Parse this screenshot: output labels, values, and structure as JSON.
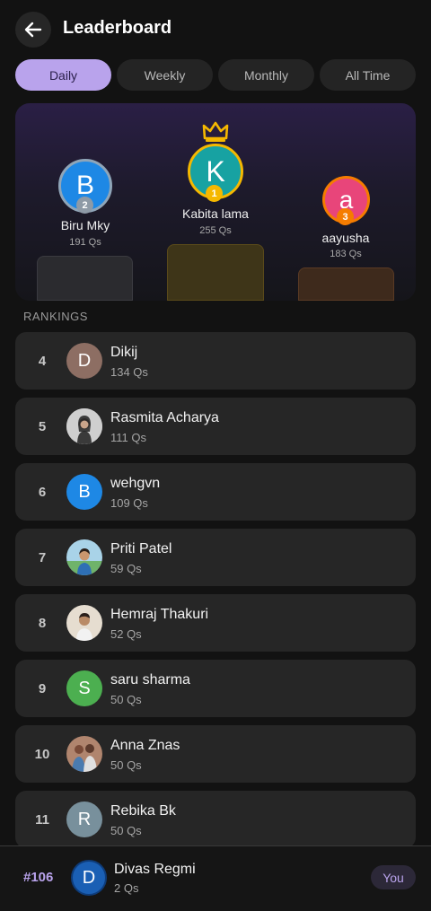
{
  "header": {
    "title": "Leaderboard",
    "back_icon": "arrow-left-icon"
  },
  "tabs": [
    {
      "label": "Daily",
      "active": true
    },
    {
      "label": "Weekly",
      "active": false
    },
    {
      "label": "Monthly",
      "active": false
    },
    {
      "label": "All Time",
      "active": false
    }
  ],
  "podium": {
    "first": {
      "initial": "K",
      "name": "Kabita lama",
      "qs": "255 Qs",
      "rank": "1",
      "color": "#17a2a2",
      "crown_icon": "crown-icon"
    },
    "second": {
      "initial": "B",
      "name": "Biru Mky",
      "qs": "191 Qs",
      "rank": "2",
      "color": "#1e88e5"
    },
    "third": {
      "initial": "a",
      "name": "aayusha",
      "qs": "183 Qs",
      "rank": "3",
      "color": "#e8457a"
    }
  },
  "rankings_label": "RANKINGS",
  "rankings": [
    {
      "rank": "4",
      "initial": "D",
      "name": "Dikij",
      "qs": "134 Qs",
      "avatar_type": "initial",
      "color": "#8d6e63"
    },
    {
      "rank": "5",
      "initial": "",
      "name": "Rasmita Acharya",
      "qs": "111 Qs",
      "avatar_type": "photo",
      "color": "#9e9e9e"
    },
    {
      "rank": "6",
      "initial": "B",
      "name": "wehgvn",
      "qs": "109 Qs",
      "avatar_type": "initial",
      "color": "#1e88e5"
    },
    {
      "rank": "7",
      "initial": "",
      "name": "Priti Patel",
      "qs": "59 Qs",
      "avatar_type": "photo",
      "color": "#6fa7c9"
    },
    {
      "rank": "8",
      "initial": "",
      "name": "Hemraj Thakuri",
      "qs": "52 Qs",
      "avatar_type": "photo",
      "color": "#b8a58e"
    },
    {
      "rank": "9",
      "initial": "S",
      "name": "saru sharma",
      "qs": "50 Qs",
      "avatar_type": "initial",
      "color": "#4caf50"
    },
    {
      "rank": "10",
      "initial": "",
      "name": "Anna Znas",
      "qs": "50 Qs",
      "avatar_type": "photo",
      "color": "#a1685a"
    },
    {
      "rank": "11",
      "initial": "R",
      "name": "Rebika Bk",
      "qs": "50 Qs",
      "avatar_type": "initial",
      "color": "#78909c"
    }
  ],
  "current_user": {
    "rank": "#106",
    "initial": "D",
    "name": "Divas Regmi",
    "qs": "2 Qs",
    "badge": "You"
  }
}
